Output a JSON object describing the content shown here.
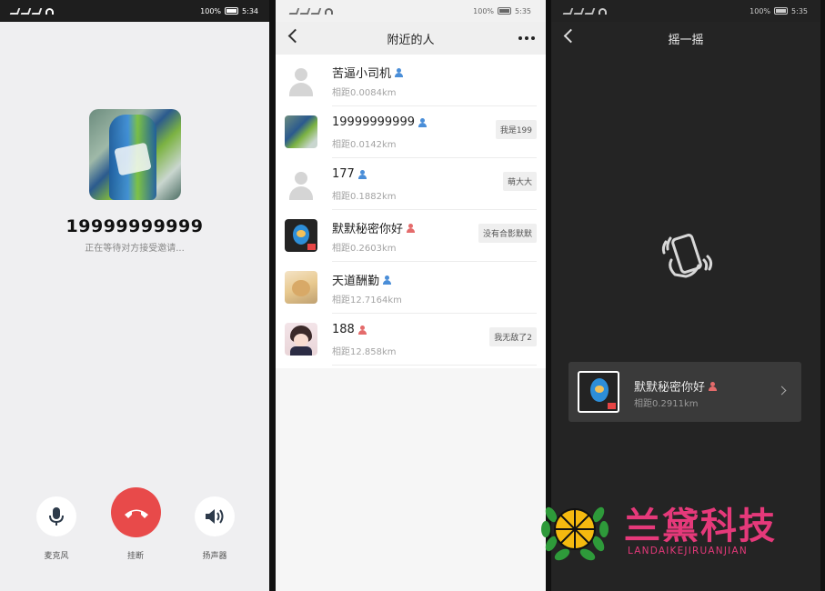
{
  "panel_call": {
    "status": {
      "battery": "100%",
      "time": "5:34"
    },
    "number": "19999999999",
    "status_text": "正在等待对方接受邀请...",
    "buttons": {
      "mic": "麦克风",
      "hangup": "挂断",
      "speaker": "扬声器"
    }
  },
  "panel_nearby": {
    "status": {
      "battery": "100%",
      "time": "5:35"
    },
    "title": "附近的人",
    "items": [
      {
        "name": "苦逼小司机",
        "gender": "male",
        "distance": "相距0.0084km",
        "tag": ""
      },
      {
        "name": "19999999999",
        "gender": "male",
        "distance": "相距0.0142km",
        "tag": "我是199"
      },
      {
        "name": "177",
        "gender": "male",
        "distance": "相距0.1882km",
        "tag": "萌大大"
      },
      {
        "name": "默默秘密你好",
        "gender": "female",
        "distance": "相距0.2603km",
        "tag": "没有合影默默"
      },
      {
        "name": "天道酬勤",
        "gender": "male",
        "distance": "相距12.7164km",
        "tag": ""
      },
      {
        "name": "188",
        "gender": "female",
        "distance": "相距12.858km",
        "tag": "我无敌了2"
      }
    ]
  },
  "panel_shake": {
    "status": {
      "battery": "100%",
      "time": "5:35"
    },
    "title": "摇一摇",
    "result": {
      "name": "默默秘密你好",
      "gender": "female",
      "distance": "相距0.2911km"
    }
  },
  "watermark": {
    "cn": "兰黛科技",
    "en": "LANDAIKEJIRUANJIAN"
  },
  "colors": {
    "hangup": "#e84a4a",
    "male": "#4a8ed8",
    "female": "#e46b6b",
    "brand": "#e5397a"
  }
}
